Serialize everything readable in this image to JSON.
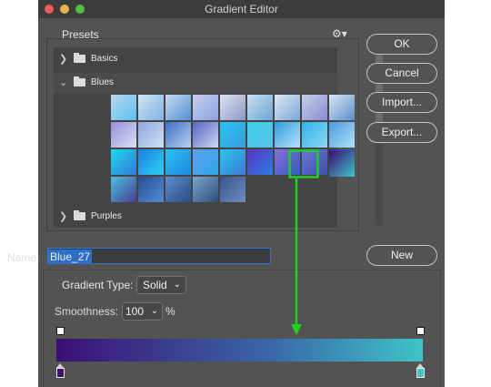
{
  "window": {
    "title": "Gradient Editor"
  },
  "presets": {
    "label": "Presets",
    "folders": [
      {
        "label": "Basics",
        "expanded": false
      },
      {
        "label": "Blues",
        "expanded": true
      },
      {
        "label": "Purples",
        "expanded": false
      }
    ],
    "swatches": [
      [
        "#b9d7ef",
        "#5cc0f2"
      ],
      [
        "#d1e4f5",
        "#7fb3e0"
      ],
      [
        "#c8dcf0",
        "#4f8fd4"
      ],
      [
        "#c6d0ee",
        "#8aa2dc"
      ],
      [
        "#e0e4f2",
        "#8b96c8"
      ],
      [
        "#c7e3f3",
        "#6fa3d6"
      ],
      [
        "#dde8f4",
        "#7aa7d8"
      ],
      [
        "#c3cfea",
        "#8d8bd0"
      ],
      [
        "#d8e6f3",
        "#5d8ecb"
      ],
      [
        "#9a8ed6",
        "#d5e1f5"
      ],
      [
        "#8fa6dc",
        "#cde2f5"
      ],
      [
        "#3f70c4",
        "#b7d1ef"
      ],
      [
        "#5566c4",
        "#cbd7f1"
      ],
      [
        "#27c6f3",
        "#3a9bdc"
      ],
      [
        "#37cfea",
        "#5cc3e6"
      ],
      [
        "#2f9de0",
        "#b8e3f7"
      ],
      [
        "#2bb3ea",
        "#8fd8f3"
      ],
      [
        "#4c9ae0",
        "#b0e2f4"
      ],
      [
        "#1fd9ee",
        "#2f7ad8"
      ],
      [
        "#1b7fe3",
        "#2fd0f0"
      ],
      [
        "#2ac3f2",
        "#2086df"
      ],
      [
        "#5fa0ea",
        "#2ea7eb"
      ],
      [
        "#2dc6ea",
        "#3a78db"
      ],
      [
        "#5a33c2",
        "#2a7fe0"
      ],
      [
        "#8a6fd9",
        "#2e5cc4"
      ],
      [
        "#6c79d4",
        "#3f4fb0"
      ],
      [
        "#3b2a9c",
        "#3c7dd0"
      ],
      [
        "#4bbfe0",
        "#4a3d8f"
      ],
      [
        "#2a4d8f",
        "#4f8fd8"
      ],
      [
        "#5b8ecb",
        "#2a4c86"
      ],
      [
        "#7da4c8",
        "#2c4f7a"
      ],
      [
        "#38548a",
        "#6b8fc4"
      ]
    ]
  },
  "buttons": {
    "ok": "OK",
    "cancel": "Cancel",
    "import": "Import...",
    "export": "Export...",
    "new": "New"
  },
  "name": {
    "label": "Name:",
    "value": "Blue_27"
  },
  "gradient": {
    "type_label": "Gradient Type:",
    "type_value": "Solid",
    "smoothness_label": "Smoothness:",
    "smoothness_value": "100",
    "smoothness_unit": "%",
    "stops": [
      "#3b0f73",
      "#3ec5c8"
    ]
  },
  "annotation": {
    "color": "#1fd11f"
  },
  "icons": {
    "gear": "gear-icon",
    "folder": "folder-icon",
    "chevron": "chevron-icon"
  }
}
